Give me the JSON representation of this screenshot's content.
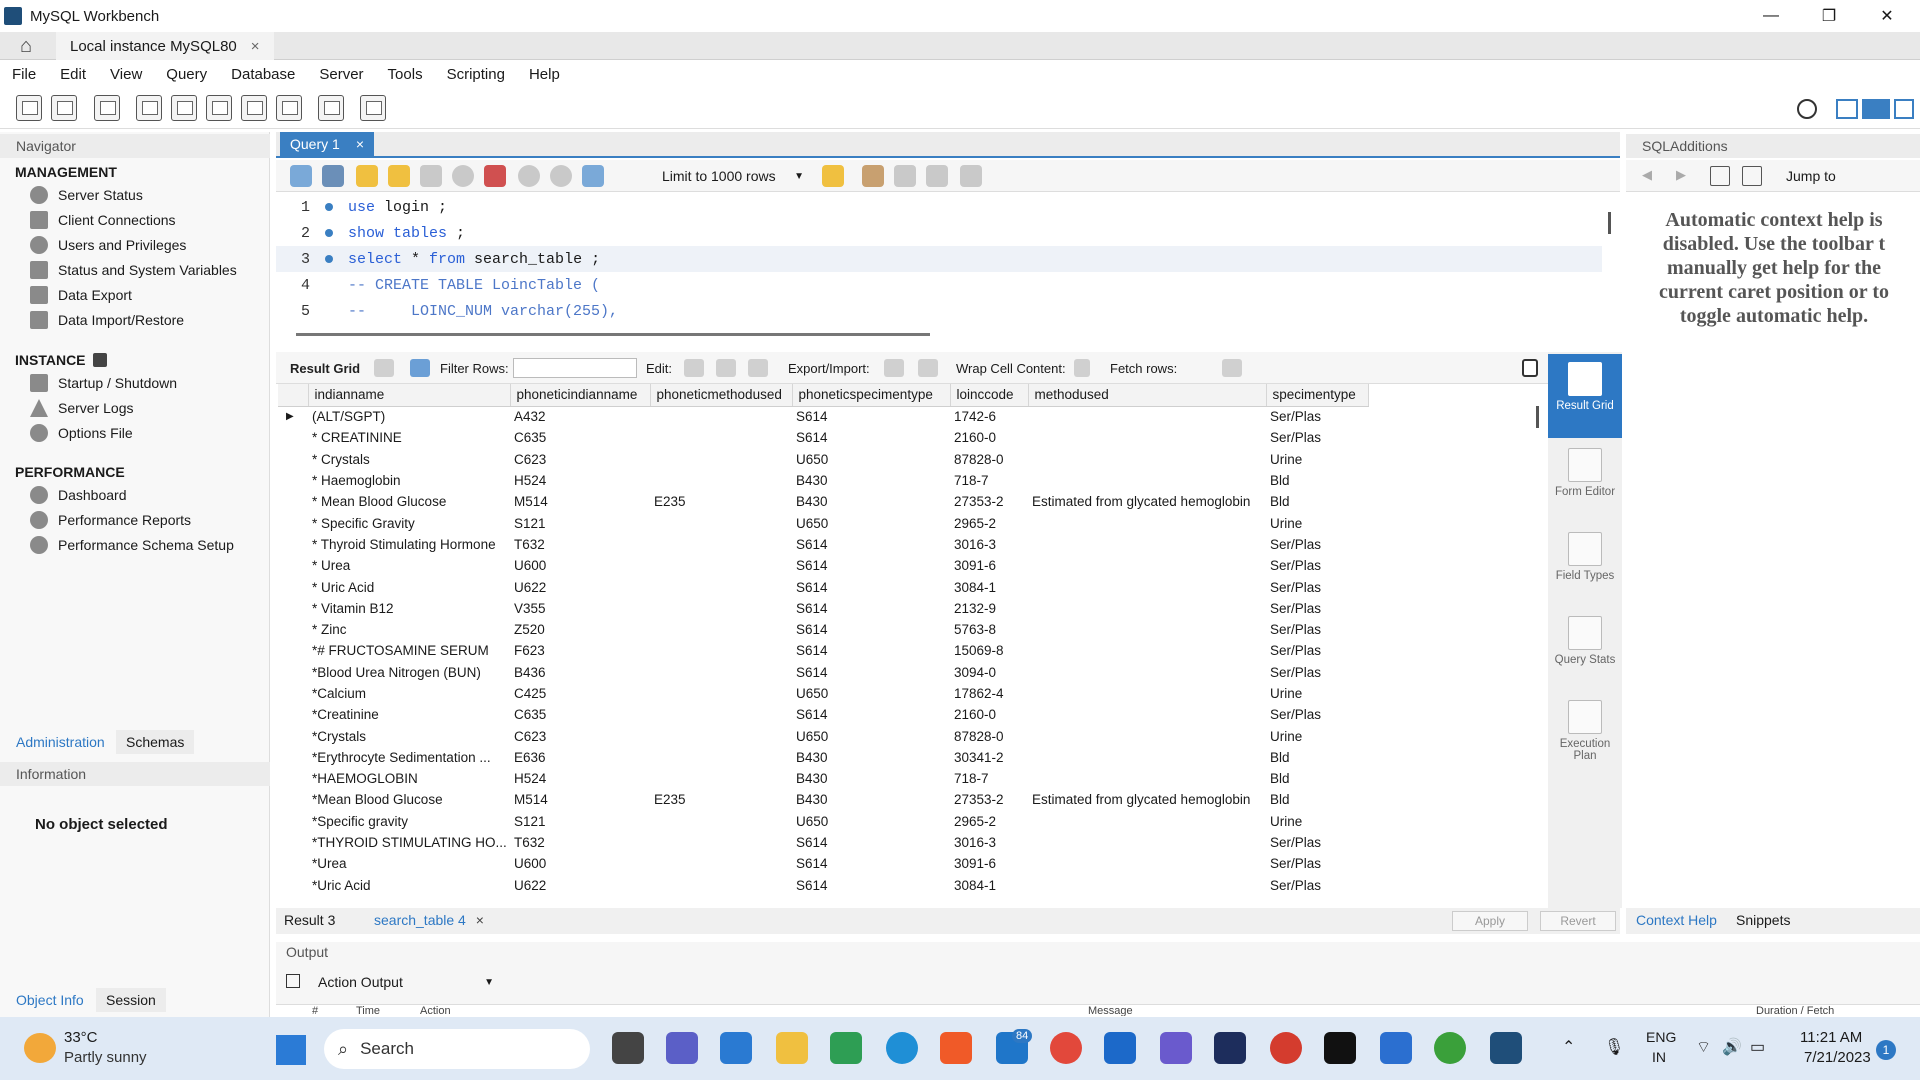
{
  "window": {
    "title": "MySQL Workbench",
    "minimize": "—",
    "maximize": "❐",
    "close": "✕"
  },
  "tabs": {
    "connection_tab": "Local instance MySQL80",
    "close": "×"
  },
  "menu": [
    "File",
    "Edit",
    "View",
    "Query",
    "Database",
    "Server",
    "Tools",
    "Scripting",
    "Help"
  ],
  "navigator": {
    "header": "Navigator",
    "management_title": "MANAGEMENT",
    "management": [
      "Server Status",
      "Client Connections",
      "Users and Privileges",
      "Status and System Variables",
      "Data Export",
      "Data Import/Restore"
    ],
    "instance_title": "INSTANCE",
    "instance": [
      "Startup / Shutdown",
      "Server Logs",
      "Options File"
    ],
    "performance_title": "PERFORMANCE",
    "performance": [
      "Dashboard",
      "Performance Reports",
      "Performance Schema Setup"
    ],
    "tabs": [
      "Administration",
      "Schemas"
    ],
    "info_header": "Information",
    "no_object": "No object selected",
    "bottom_tabs": [
      "Object Info",
      "Session"
    ]
  },
  "query_tab": {
    "label": "Query 1",
    "close": "×"
  },
  "editor_toolbar": {
    "limit": "Limit to 1000 rows"
  },
  "editor": {
    "lines": [
      {
        "num": "1",
        "parts": [
          [
            "kw",
            "use"
          ],
          [
            "tx",
            " login ;"
          ]
        ]
      },
      {
        "num": "2",
        "parts": [
          [
            "kw",
            "show tables"
          ],
          [
            "tx",
            " ;"
          ]
        ]
      },
      {
        "num": "3",
        "parts": [
          [
            "kw",
            "select"
          ],
          [
            "tx",
            " * "
          ],
          [
            "kw",
            "from"
          ],
          [
            "tx",
            " search_table ;"
          ]
        ]
      },
      {
        "num": "4",
        "parts": [
          [
            "cm",
            "-- CREATE TABLE LoincTable ("
          ]
        ]
      },
      {
        "num": "5",
        "parts": [
          [
            "cm",
            "--     LOINC_NUM varchar(255),"
          ]
        ]
      }
    ]
  },
  "result_toolbar": {
    "result_grid": "Result Grid",
    "filter_rows": "Filter Rows:",
    "edit": "Edit:",
    "export_import": "Export/Import:",
    "wrap": "Wrap Cell Content:",
    "fetch": "Fetch rows:"
  },
  "grid": {
    "columns": [
      "indianname",
      "phoneticindianname",
      "phoneticmethodused",
      "phoneticspecimentype",
      "loinccode",
      "methodused",
      "specimentype"
    ],
    "rows": [
      [
        "(ALT/SGPT)",
        "A432",
        "",
        "S614",
        "1742-6",
        "",
        "Ser/Plas"
      ],
      [
        "* CREATININE",
        "C635",
        "",
        "S614",
        "2160-0",
        "",
        "Ser/Plas"
      ],
      [
        "* Crystals",
        "C623",
        "",
        "U650",
        "87828-0",
        "",
        "Urine"
      ],
      [
        "* Haemoglobin",
        "H524",
        "",
        "B430",
        "718-7",
        "",
        "Bld"
      ],
      [
        "* Mean Blood Glucose",
        "M514",
        "E235",
        "B430",
        "27353-2",
        "Estimated from glycated hemoglobin",
        "Bld"
      ],
      [
        "* Specific Gravity",
        "S121",
        "",
        "U650",
        "2965-2",
        "",
        "Urine"
      ],
      [
        "* Thyroid Stimulating Hormone",
        "T632",
        "",
        "S614",
        "3016-3",
        "",
        "Ser/Plas"
      ],
      [
        "* Urea",
        "U600",
        "",
        "S614",
        "3091-6",
        "",
        "Ser/Plas"
      ],
      [
        "* Uric Acid",
        "U622",
        "",
        "S614",
        "3084-1",
        "",
        "Ser/Plas"
      ],
      [
        "* Vitamin B12",
        "V355",
        "",
        "S614",
        "2132-9",
        "",
        "Ser/Plas"
      ],
      [
        "* Zinc",
        "Z520",
        "",
        "S614",
        "5763-8",
        "",
        "Ser/Plas"
      ],
      [
        "*# FRUCTOSAMINE SERUM",
        "F623",
        "",
        "S614",
        "15069-8",
        "",
        "Ser/Plas"
      ],
      [
        "*Blood Urea Nitrogen (BUN)",
        "B436",
        "",
        "S614",
        "3094-0",
        "",
        "Ser/Plas"
      ],
      [
        "*Calcium",
        "C425",
        "",
        "U650",
        "17862-4",
        "",
        "Urine"
      ],
      [
        "*Creatinine",
        "C635",
        "",
        "S614",
        "2160-0",
        "",
        "Ser/Plas"
      ],
      [
        "*Crystals",
        "C623",
        "",
        "U650",
        "87828-0",
        "",
        "Urine"
      ],
      [
        "*Erythrocyte Sedimentation ...",
        "E636",
        "",
        "B430",
        "30341-2",
        "",
        "Bld"
      ],
      [
        "*HAEMOGLOBIN",
        "H524",
        "",
        "B430",
        "718-7",
        "",
        "Bld"
      ],
      [
        "*Mean Blood Glucose",
        "M514",
        "E235",
        "B430",
        "27353-2",
        "Estimated from glycated hemoglobin",
        "Bld"
      ],
      [
        "*Specific gravity",
        "S121",
        "",
        "U650",
        "2965-2",
        "",
        "Urine"
      ],
      [
        "*THYROID STIMULATING HO...",
        "T632",
        "",
        "S614",
        "3016-3",
        "",
        "Ser/Plas"
      ],
      [
        "*Urea",
        "U600",
        "",
        "S614",
        "3091-6",
        "",
        "Ser/Plas"
      ],
      [
        "*Uric Acid",
        "U622",
        "",
        "S614",
        "3084-1",
        "",
        "Ser/Plas"
      ]
    ]
  },
  "side_tabs": [
    "Result Grid",
    "Form Editor",
    "Field Types",
    "Query Stats",
    "Execution Plan"
  ],
  "bottom_tabs": {
    "result3": "Result 3",
    "search_table": "search_table 4",
    "close": "×",
    "apply": "Apply",
    "revert": "Revert"
  },
  "output": {
    "label": "Output",
    "select": "Action Output",
    "col_hash": "#",
    "col_time": "Time",
    "col_action": "Action",
    "col_message": "Message",
    "col_duration": "Duration / Fetch"
  },
  "sql_additions": {
    "header": "SQLAdditions",
    "jump_to": "Jump to",
    "help_text": "Automatic context help is disabled. Use the toolbar t manually get help for the current caret position or to toggle automatic help.",
    "tabs": [
      "Context Help",
      "Snippets"
    ]
  },
  "taskbar": {
    "weather_temp": "33°C",
    "weather_desc": "Partly sunny",
    "search": "Search",
    "mail_badge": "84",
    "lang_top": "ENG",
    "lang_bottom": "IN",
    "time": "11:21 AM",
    "date": "7/21/2023",
    "notif": "1"
  },
  "colors": {
    "accent": "#3a7fc2",
    "taskbar": "#dfe9f5"
  }
}
